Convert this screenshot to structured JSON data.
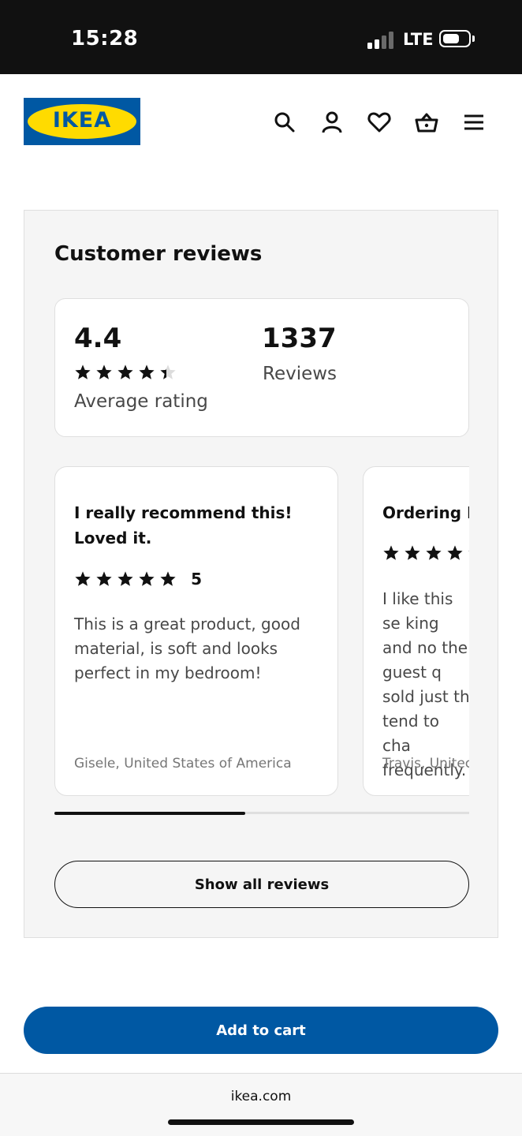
{
  "status_bar": {
    "time": "15:28",
    "network": "LTE"
  },
  "header": {
    "logo_text": "IKEA",
    "icons": [
      "search-icon",
      "account-icon",
      "heart-icon",
      "basket-icon",
      "menu-icon"
    ]
  },
  "reviews": {
    "title": "Customer reviews",
    "average": {
      "value": "4.4",
      "rating": 4.4,
      "label": "Average rating"
    },
    "count": {
      "value": "1337",
      "label": "Reviews"
    },
    "cards": [
      {
        "title": "I really recommend this! Loved it.",
        "rating": 5,
        "rating_text": "5",
        "body": "This is a great product, good material, is soft and looks perfect in my bedroom!",
        "author": "Gisele, United States of America"
      },
      {
        "title": "Ordering M",
        "rating": 4.5,
        "rating_text": "",
        "body": "I like this se king and no the guest q sold just th tend to cha frequently.",
        "author": "Travis, Unitec"
      }
    ],
    "carousel_progress": 0.46,
    "show_all_label": "Show all reviews"
  },
  "cta": {
    "add_to_cart_label": "Add to cart"
  },
  "browser": {
    "url": "ikea.com"
  },
  "colors": {
    "brand_blue": "#0058a3",
    "brand_yellow": "#ffdb00",
    "panel_bg": "#f5f5f5",
    "text": "#111111"
  }
}
